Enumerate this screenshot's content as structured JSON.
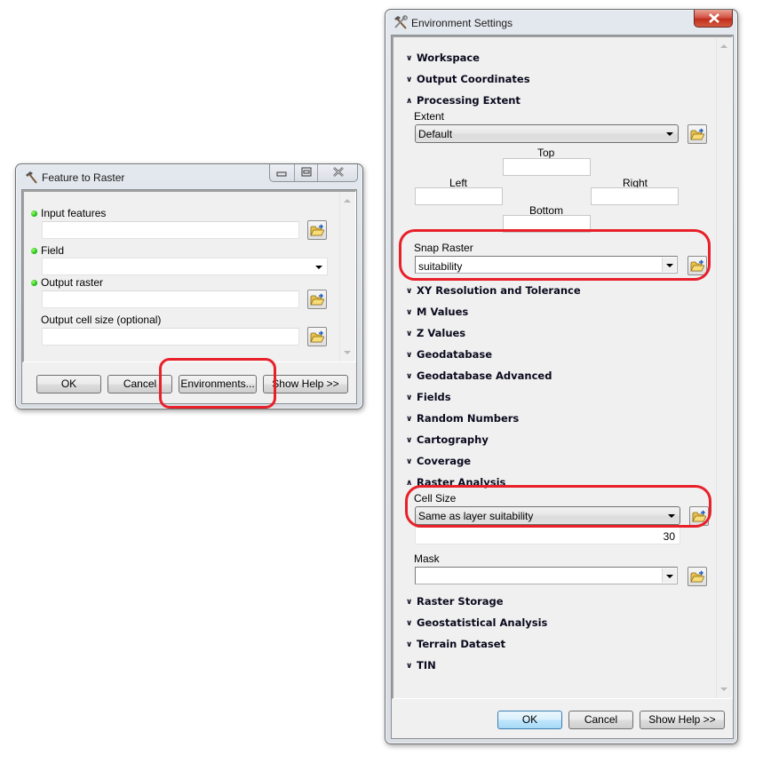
{
  "feature_to_raster": {
    "title": "Feature to Raster",
    "params": [
      {
        "label": "Input features",
        "required": true,
        "value": "",
        "type": "text"
      },
      {
        "label": "Field",
        "required": true,
        "value": "",
        "type": "dropdown"
      },
      {
        "label": "Output raster",
        "required": true,
        "value": "",
        "type": "text"
      },
      {
        "label": "Output cell size (optional)",
        "required": false,
        "value": "",
        "type": "text"
      }
    ],
    "buttons": {
      "ok": "OK",
      "cancel": "Cancel",
      "environments": "Environments...",
      "show_help": "Show Help >>"
    }
  },
  "environment_settings": {
    "title": "Environment Settings",
    "sections": {
      "workspace": {
        "label": "Workspace",
        "expanded": false
      },
      "output_coordinates": {
        "label": "Output Coordinates",
        "expanded": false
      },
      "processing_extent": {
        "label": "Processing Extent",
        "expanded": true
      },
      "xy_resolution": {
        "label": "XY Resolution and Tolerance",
        "expanded": false
      },
      "m_values": {
        "label": "M Values",
        "expanded": false
      },
      "z_values": {
        "label": "Z Values",
        "expanded": false
      },
      "geodatabase": {
        "label": "Geodatabase",
        "expanded": false
      },
      "geodatabase_advanced": {
        "label": "Geodatabase Advanced",
        "expanded": false
      },
      "fields": {
        "label": "Fields",
        "expanded": false
      },
      "random_numbers": {
        "label": "Random Numbers",
        "expanded": false
      },
      "cartography": {
        "label": "Cartography",
        "expanded": false
      },
      "coverage": {
        "label": "Coverage",
        "expanded": false
      },
      "raster_analysis": {
        "label": "Raster Analysis",
        "expanded": true
      },
      "raster_storage": {
        "label": "Raster Storage",
        "expanded": false
      },
      "geostatistical": {
        "label": "Geostatistical Analysis",
        "expanded": false
      },
      "terrain_dataset": {
        "label": "Terrain Dataset",
        "expanded": false
      },
      "tin": {
        "label": "TIN",
        "expanded": false
      }
    },
    "extent": {
      "label": "Extent",
      "value": "Default",
      "top_label": "Top",
      "left_label": "Left",
      "right_label": "Right",
      "bottom_label": "Bottom",
      "top": "",
      "left": "",
      "right": "",
      "bottom": ""
    },
    "snap_raster": {
      "label": "Snap Raster",
      "value": "suitability"
    },
    "cell_size": {
      "label": "Cell Size",
      "value": "Same as layer suitability",
      "numeric": "30"
    },
    "mask": {
      "label": "Mask",
      "value": ""
    },
    "buttons": {
      "ok": "OK",
      "cancel": "Cancel",
      "show_help": "Show Help >>"
    }
  },
  "icons": {
    "collapsed": "≫",
    "expanded": "≪"
  },
  "annotation_color": "#e8202a"
}
